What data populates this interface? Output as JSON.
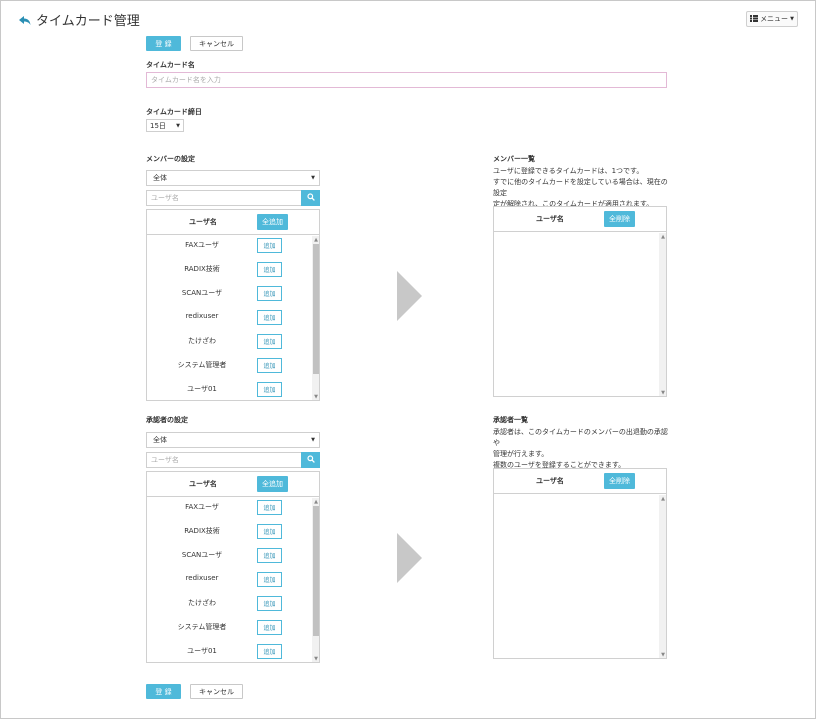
{
  "header": {
    "title": "タイムカード管理",
    "menu_label": "メニュー"
  },
  "actions": {
    "register": "登 録",
    "cancel": "キャンセル"
  },
  "form": {
    "name_label": "タイムカード名",
    "name_placeholder": "タイムカード名を入力",
    "closing_label": "タイムカード締日",
    "closing_value": "15日"
  },
  "members": {
    "section_label": "メンバーの設定",
    "filter_value": "全体",
    "search_placeholder": "ユーザ名",
    "col_user": "ユーザ名",
    "add_all": "全追加",
    "add_label": "追加",
    "users": [
      "FAXユーザ",
      "RADIX技術",
      "SCANユーザ",
      "redixuser",
      "たけざわ",
      "システム管理者",
      "ユーザ01"
    ],
    "list_title": "メンバー一覧",
    "list_desc": [
      "ユーザに登録できるタイムカードは、1つです。",
      "すでに他のタイムカードを設定している場合は、現在の設定",
      "定が解除され、このタイムカードが適用されます。"
    ],
    "remove_all": "全削除"
  },
  "approvers": {
    "section_label": "承認者の設定",
    "filter_value": "全体",
    "search_placeholder": "ユーザ名",
    "col_user": "ユーザ名",
    "add_all": "全追加",
    "add_label": "追加",
    "users": [
      "FAXユーザ",
      "RADIX技術",
      "SCANユーザ",
      "redixuser",
      "たけざわ",
      "システム管理者",
      "ユーザ01"
    ],
    "list_title": "承認者一覧",
    "list_desc": [
      "承認者は、このタイムカードのメンバーの出退勤の承認や",
      "管理が行えます。",
      "複数のユーザを登録することができます。"
    ],
    "remove_all": "全削除"
  },
  "colors": {
    "accent": "#4fb9da",
    "arrow": "#c8c8c8"
  }
}
